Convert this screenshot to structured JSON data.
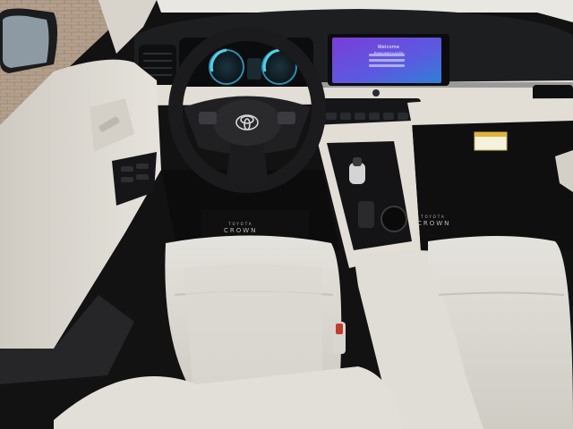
{
  "image": {
    "subject": "car-interior",
    "steering_wheel_badge": "toyota-logo",
    "infotainment_screen": {
      "title": "Welcome",
      "subtitle": "Please select a profile"
    },
    "floor_mats": {
      "brand_small": "TOYOTA",
      "model": "CROWN"
    },
    "colors": {
      "upholstery": "#dcd9d2",
      "dashboard": "#1d1e20",
      "screen_gradient_start": "#7a3dd8",
      "screen_gradient_end": "#2f7fd8",
      "trim": "#b9b9b9"
    }
  }
}
